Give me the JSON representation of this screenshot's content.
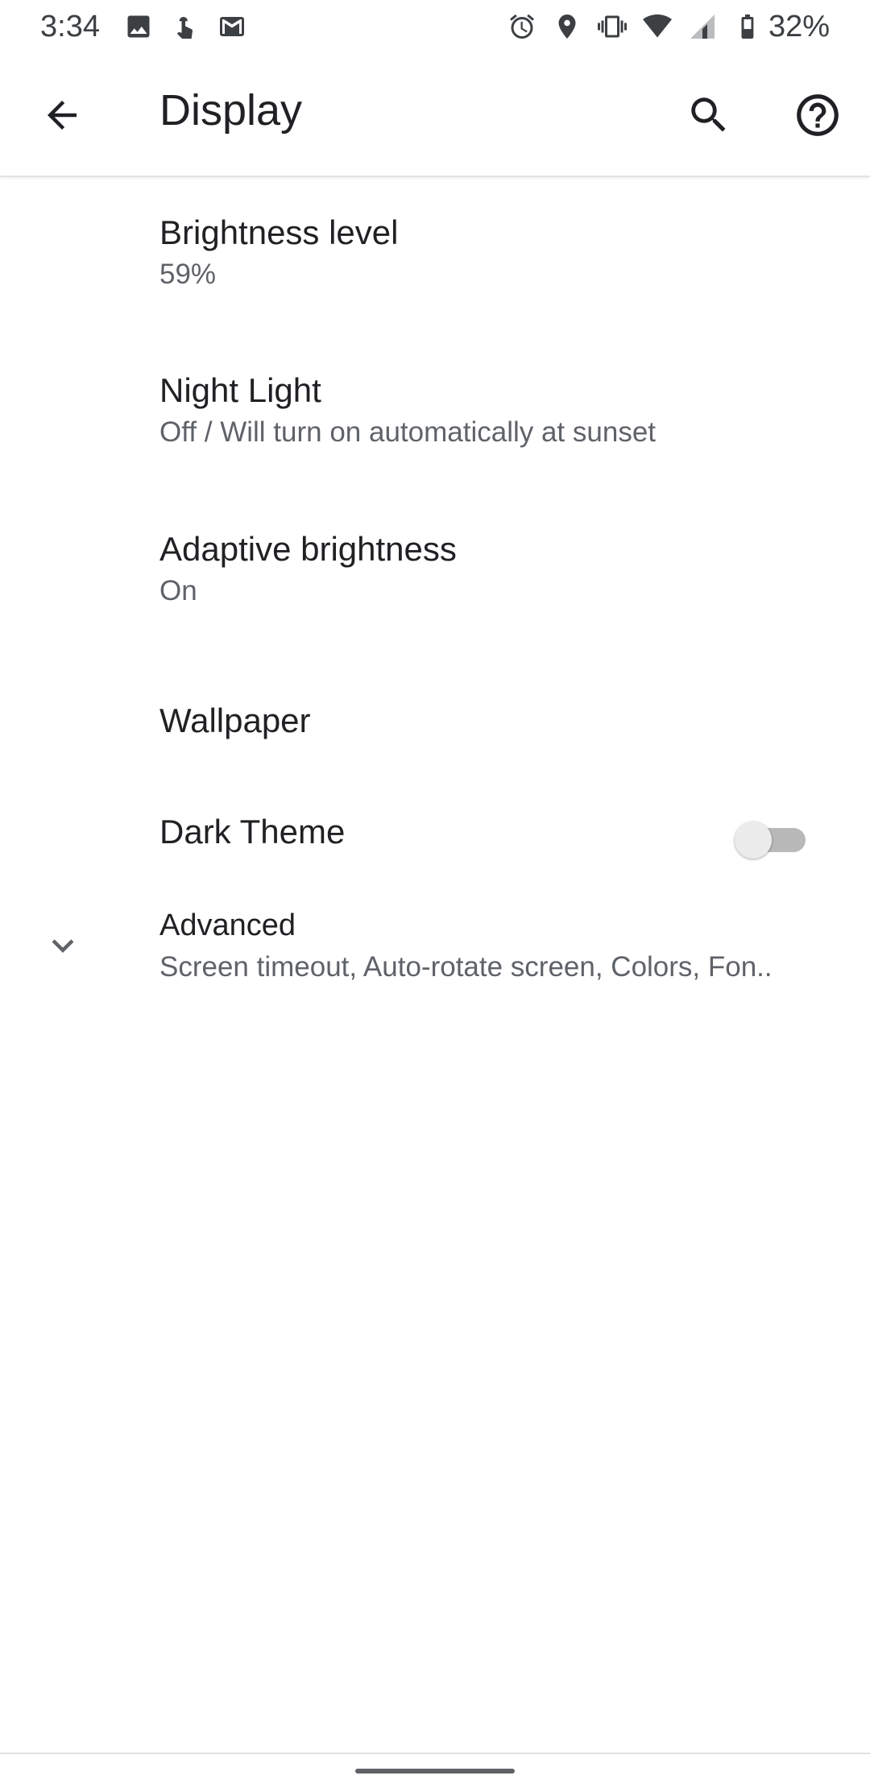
{
  "status_bar": {
    "time": "3:34",
    "left_icons": [
      "image-icon",
      "touch-icon",
      "gmail-icon"
    ],
    "right_icons": [
      "alarm-icon",
      "location-icon",
      "vibrate-icon",
      "wifi-icon",
      "signal-icon",
      "battery-icon"
    ],
    "battery_percent": "32%"
  },
  "app_bar": {
    "title": "Display",
    "actions": [
      "back-arrow-icon",
      "search-icon",
      "help-icon"
    ]
  },
  "settings": {
    "brightness": {
      "title": "Brightness level",
      "summary": "59%"
    },
    "night_light": {
      "title": "Night Light",
      "summary": "Off / Will turn on automatically at sunset"
    },
    "adaptive_brightness": {
      "title": "Adaptive brightness",
      "summary": "On"
    },
    "wallpaper": {
      "title": "Wallpaper"
    },
    "dark_theme": {
      "title": "Dark Theme",
      "enabled": false
    },
    "advanced": {
      "title": "Advanced",
      "summary": "Screen timeout, Auto-rotate screen, Colors, Fon.."
    }
  },
  "colors": {
    "primary_text": "#202124",
    "secondary_text": "#5f6368",
    "toggle_off_track": "#b9b9b9",
    "toggle_off_thumb": "#ececec"
  }
}
